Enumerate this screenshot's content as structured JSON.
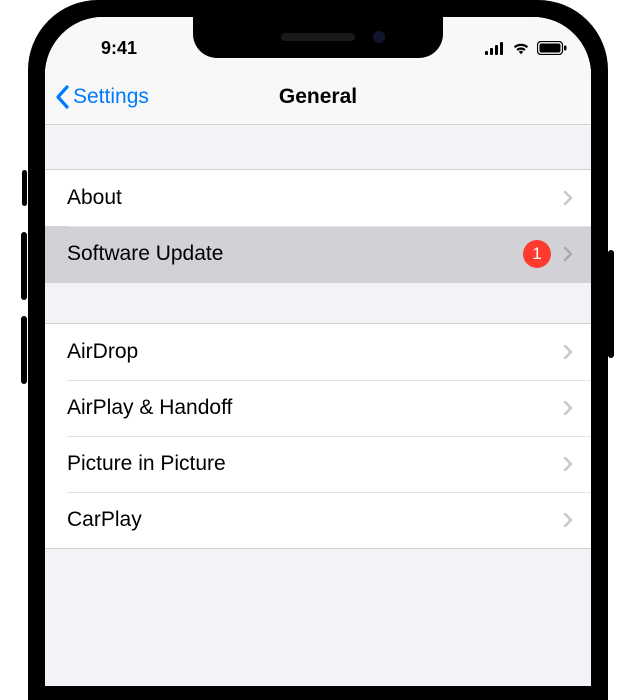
{
  "status": {
    "time": "9:41"
  },
  "nav": {
    "back_label": "Settings",
    "title": "General"
  },
  "sections": [
    {
      "rows": [
        {
          "label": "About",
          "badge": null,
          "highlight": false
        },
        {
          "label": "Software Update",
          "badge": "1",
          "highlight": true
        }
      ]
    },
    {
      "rows": [
        {
          "label": "AirDrop",
          "badge": null,
          "highlight": false
        },
        {
          "label": "AirPlay & Handoff",
          "badge": null,
          "highlight": false
        },
        {
          "label": "Picture in Picture",
          "badge": null,
          "highlight": false
        },
        {
          "label": "CarPlay",
          "badge": null,
          "highlight": false
        }
      ]
    }
  ],
  "colors": {
    "tint": "#007aff",
    "badge": "#ff3b30",
    "separator": "#d1d1d6",
    "group_bg": "#f2f2f7"
  }
}
